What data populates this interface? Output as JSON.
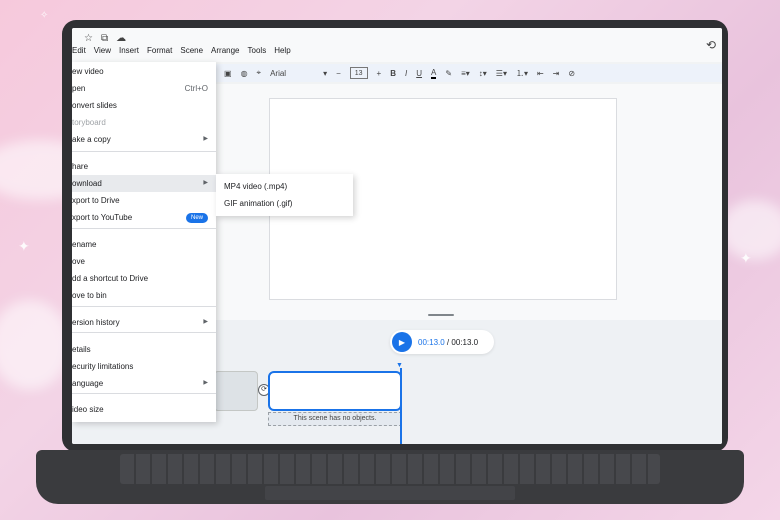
{
  "top_icons": [
    "☆",
    "⧉",
    "☁"
  ],
  "menu_bar": [
    "Edit",
    "View",
    "Insert",
    "Format",
    "Scene",
    "Arrange",
    "Tools",
    "Help"
  ],
  "toolbar": {
    "font": "Arial",
    "font_size": "13",
    "bold": "B",
    "italic": "I",
    "underline": "U",
    "text_color": "A",
    "minus": "−",
    "plus": "+"
  },
  "file_menu": [
    {
      "label": "ew video",
      "shortcut": "",
      "arrow": false,
      "badge": "",
      "disabled": false,
      "highlight": false
    },
    {
      "label": "pen",
      "shortcut": "Ctrl+O",
      "arrow": false,
      "badge": "",
      "disabled": false,
      "highlight": false
    },
    {
      "label": "onvert slides",
      "shortcut": "",
      "arrow": false,
      "badge": "",
      "disabled": false,
      "highlight": false
    },
    {
      "label": "toryboard",
      "shortcut": "",
      "arrow": false,
      "badge": "",
      "disabled": true,
      "highlight": false
    },
    {
      "label": "ake a copy",
      "shortcut": "",
      "arrow": true,
      "badge": "",
      "disabled": false,
      "highlight": false
    },
    {
      "label": "hare",
      "shortcut": "",
      "arrow": false,
      "badge": "",
      "disabled": false,
      "highlight": false
    },
    {
      "label": "ownload",
      "shortcut": "",
      "arrow": true,
      "badge": "",
      "disabled": false,
      "highlight": true
    },
    {
      "label": "xport to Drive",
      "shortcut": "",
      "arrow": false,
      "badge": "",
      "disabled": false,
      "highlight": false
    },
    {
      "label": "xport to YouTube",
      "shortcut": "",
      "arrow": false,
      "badge": "New",
      "disabled": false,
      "highlight": false
    },
    {
      "label": "ename",
      "shortcut": "",
      "arrow": false,
      "badge": "",
      "disabled": false,
      "highlight": false
    },
    {
      "label": "ove",
      "shortcut": "",
      "arrow": false,
      "badge": "",
      "disabled": false,
      "highlight": false
    },
    {
      "label": "dd a shortcut to Drive",
      "shortcut": "",
      "arrow": false,
      "badge": "",
      "disabled": false,
      "highlight": false
    },
    {
      "label": "ove to bin",
      "shortcut": "",
      "arrow": false,
      "badge": "",
      "disabled": false,
      "highlight": false
    },
    {
      "label": "ersion history",
      "shortcut": "",
      "arrow": true,
      "badge": "",
      "disabled": false,
      "highlight": false
    },
    {
      "label": "etails",
      "shortcut": "",
      "arrow": false,
      "badge": "",
      "disabled": false,
      "highlight": false
    },
    {
      "label": "ecurity limitations",
      "shortcut": "",
      "arrow": false,
      "badge": "",
      "disabled": false,
      "highlight": false
    },
    {
      "label": "anguage",
      "shortcut": "",
      "arrow": true,
      "badge": "",
      "disabled": false,
      "highlight": false
    },
    {
      "label": "ideo size",
      "shortcut": "",
      "arrow": false,
      "badge": "",
      "disabled": false,
      "highlight": false
    }
  ],
  "download_submenu": [
    "MP4 video (.mp4)",
    "GIF animation (.gif)"
  ],
  "player": {
    "current": "00:13.0",
    "separator": " / ",
    "total": "00:13.0"
  },
  "scene_note": "This scene has no objects.",
  "colors": {
    "accent": "#1a73e8"
  }
}
